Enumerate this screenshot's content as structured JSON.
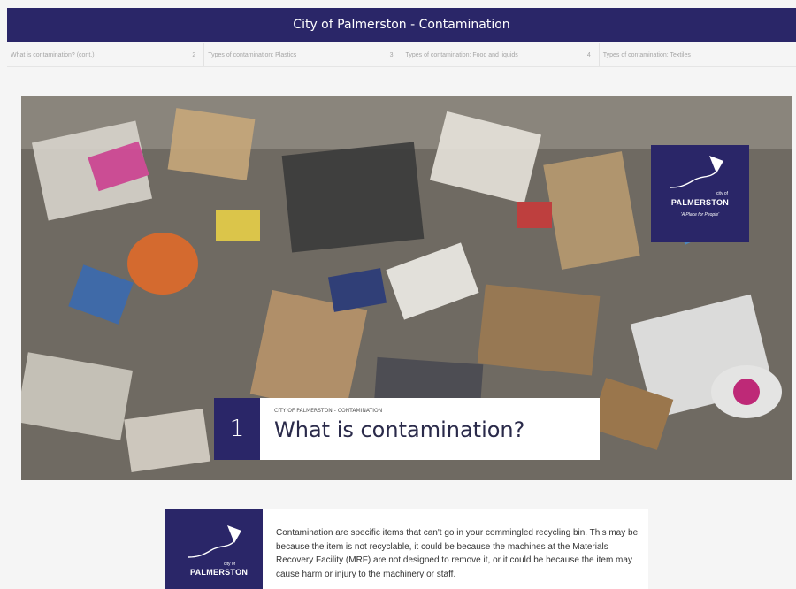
{
  "header": {
    "title": "City of Palmerston - Contamination"
  },
  "tabs": [
    {
      "label": "What is contamination? (cont.)",
      "number": "2"
    },
    {
      "label": "Types of contamination: Plastics",
      "number": "3"
    },
    {
      "label": "Types of contamination: Food and liquids",
      "number": "4"
    },
    {
      "label": "Types of contamination: Textiles",
      "number": ""
    }
  ],
  "hero": {
    "image_icon": "waste-pile-photo",
    "logo": {
      "city": "city of",
      "name": "PALMERSTON",
      "tagline": "'A Place for People'"
    }
  },
  "section": {
    "number": "1",
    "kicker": "CITY OF PALMERSTON - CONTAMINATION",
    "title": "What is contamination?"
  },
  "content": {
    "logo": {
      "city": "city of",
      "name": "PALMERSTON"
    },
    "paragraph": "Contamination are specific items that can't go in your commingled recycling bin. This may be because the item is not recyclable, it could be because the machines at the Materials Recovery Facility (MRF) are not designed to remove it, or it could be because the item may cause harm or injury to the machinery or staff."
  },
  "colors": {
    "brand_navy": "#2a2668",
    "background": "#f5f5f5"
  }
}
